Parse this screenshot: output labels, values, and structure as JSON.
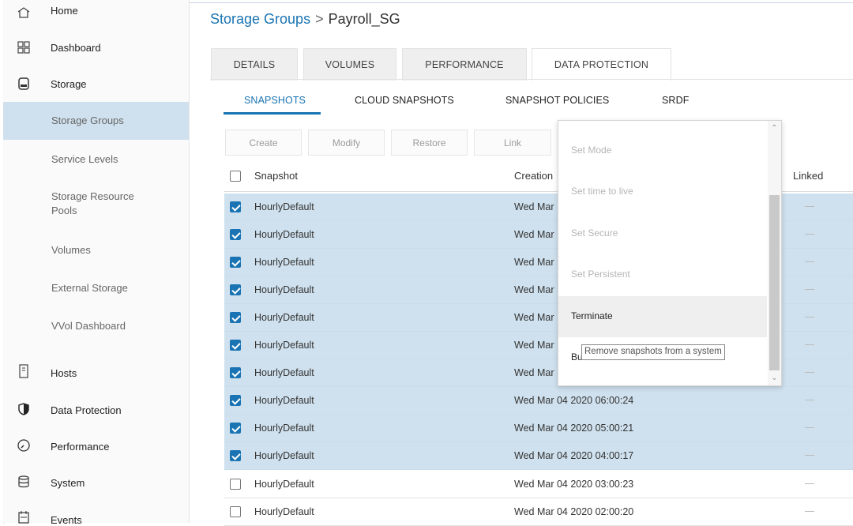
{
  "sidebar": {
    "items": [
      {
        "label": "Home",
        "icon": "home-icon"
      },
      {
        "label": "Dashboard",
        "icon": "dashboard-icon"
      },
      {
        "label": "Storage",
        "icon": "storage-icon"
      },
      {
        "label": "Hosts",
        "icon": "hosts-icon"
      },
      {
        "label": "Data Protection",
        "icon": "shield-icon"
      },
      {
        "label": "Performance",
        "icon": "gauge-icon"
      },
      {
        "label": "System",
        "icon": "database-icon"
      },
      {
        "label": "Events",
        "icon": "calendar-icon"
      }
    ],
    "storage_sub": [
      {
        "label": "Storage Groups"
      },
      {
        "label": "Service Levels"
      },
      {
        "label": "Storage Resource Pools"
      },
      {
        "label": "Volumes"
      },
      {
        "label": "External Storage"
      },
      {
        "label": "VVol Dashboard"
      }
    ]
  },
  "breadcrumb": {
    "parent": "Storage Groups",
    "separator": ">",
    "current": "Payroll_SG"
  },
  "tabs": [
    {
      "label": "DETAILS"
    },
    {
      "label": "VOLUMES"
    },
    {
      "label": "PERFORMANCE"
    },
    {
      "label": "DATA PROTECTION"
    }
  ],
  "subtabs": [
    {
      "label": "SNAPSHOTS"
    },
    {
      "label": "CLOUD SNAPSHOTS"
    },
    {
      "label": "SNAPSHOT POLICIES"
    },
    {
      "label": "SRDF"
    }
  ],
  "toolbar": {
    "create": "Create",
    "modify": "Modify",
    "restore": "Restore",
    "link": "Link"
  },
  "table": {
    "headers": {
      "snapshot": "Snapshot",
      "creation": "Creation",
      "linked": "Linked"
    },
    "rows": [
      {
        "name": "HourlyDefault",
        "creation": "Wed Mar",
        "selected": true
      },
      {
        "name": "HourlyDefault",
        "creation": "Wed Mar",
        "selected": true
      },
      {
        "name": "HourlyDefault",
        "creation": "Wed Mar",
        "selected": true
      },
      {
        "name": "HourlyDefault",
        "creation": "Wed Mar",
        "selected": true
      },
      {
        "name": "HourlyDefault",
        "creation": "Wed Mar",
        "selected": true
      },
      {
        "name": "HourlyDefault",
        "creation": "Wed Mar",
        "selected": true
      },
      {
        "name": "HourlyDefault",
        "creation": "Wed Mar",
        "selected": true
      },
      {
        "name": "HourlyDefault",
        "creation": "Wed Mar 04 2020 06:00:24",
        "selected": true
      },
      {
        "name": "HourlyDefault",
        "creation": "Wed Mar 04 2020 05:00:21",
        "selected": true
      },
      {
        "name": "HourlyDefault",
        "creation": "Wed Mar 04 2020 04:00:17",
        "selected": true
      },
      {
        "name": "HourlyDefault",
        "creation": "Wed Mar 04 2020 03:00:23",
        "selected": false
      },
      {
        "name": "HourlyDefault",
        "creation": "Wed Mar 04 2020 02:00:20",
        "selected": false
      }
    ]
  },
  "menu": {
    "items": [
      {
        "label": "Set Mode"
      },
      {
        "label": "Set time to live"
      },
      {
        "label": "Set Secure"
      },
      {
        "label": "Set Persistent"
      },
      {
        "label": "Terminate"
      },
      {
        "label": "Bulk Terminate"
      }
    ],
    "tooltip": "Remove snapshots from a system"
  },
  "colors": {
    "accent": "#1a74b3",
    "selected_row": "#cfe1ee"
  }
}
